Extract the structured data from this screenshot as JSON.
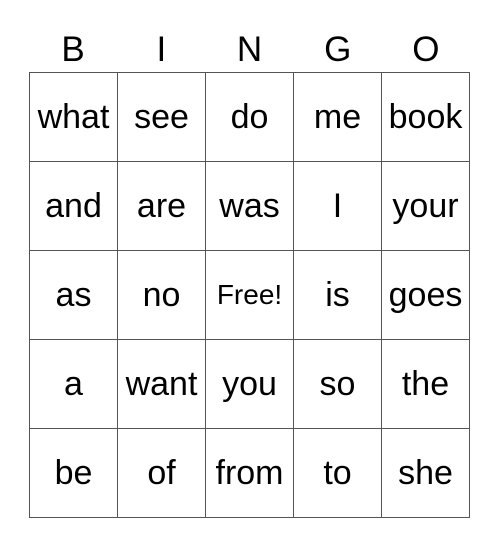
{
  "header": [
    "B",
    "I",
    "N",
    "G",
    "O"
  ],
  "rows": [
    [
      "what",
      "see",
      "do",
      "me",
      "book"
    ],
    [
      "and",
      "are",
      "was",
      "I",
      "your"
    ],
    [
      "as",
      "no",
      "Free!",
      "is",
      "goes"
    ],
    [
      "a",
      "want",
      "you",
      "so",
      "the"
    ],
    [
      "be",
      "of",
      "from",
      "to",
      "she"
    ]
  ]
}
